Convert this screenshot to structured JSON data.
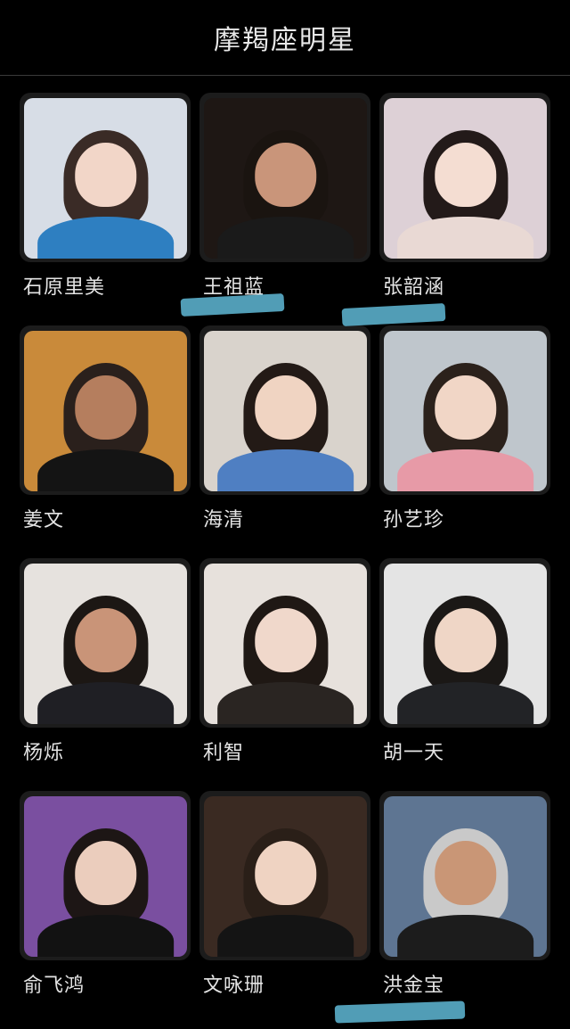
{
  "header": {
    "title": "摩羯座明星"
  },
  "celebrities": [
    {
      "name": "石原里美",
      "photo": {
        "bg": "#d7dde6",
        "hair": "#3a2b26",
        "skin": "#f2d6c8",
        "cloth": "#2e7fc1"
      }
    },
    {
      "name": "王祖蓝",
      "photo": {
        "bg": "#1e1714",
        "hair": "#1a1410",
        "skin": "#c9957a",
        "cloth": "#1a1a1a"
      }
    },
    {
      "name": "张韶涵",
      "photo": {
        "bg": "#ddd0d6",
        "hair": "#231a19",
        "skin": "#f4ddd2",
        "cloth": "#e9d9d4"
      }
    },
    {
      "name": "姜文",
      "photo": {
        "bg": "#c98a3a",
        "hair": "#2a201c",
        "skin": "#b57e5e",
        "cloth": "#141414"
      }
    },
    {
      "name": "海清",
      "photo": {
        "bg": "#d9d3cc",
        "hair": "#231a16",
        "skin": "#f0d4c2",
        "cloth": "#4f7fc2"
      }
    },
    {
      "name": "孙艺珍",
      "photo": {
        "bg": "#bfc6cc",
        "hair": "#2b211b",
        "skin": "#f1d6c6",
        "cloth": "#e79aa7"
      }
    },
    {
      "name": "杨烁",
      "photo": {
        "bg": "#e6e2de",
        "hair": "#1c1714",
        "skin": "#c99478",
        "cloth": "#1f1f24"
      }
    },
    {
      "name": "利智",
      "photo": {
        "bg": "#e7e1dc",
        "hair": "#1f1814",
        "skin": "#f0d8cb",
        "cloth": "#2a2522"
      }
    },
    {
      "name": "胡一天",
      "photo": {
        "bg": "#e4e4e4",
        "hair": "#1b1816",
        "skin": "#efd6c6",
        "cloth": "#222326"
      }
    },
    {
      "name": "俞飞鸿",
      "photo": {
        "bg": "#7a4fa0",
        "hair": "#1d1615",
        "skin": "#ebcdbd",
        "cloth": "#121212"
      }
    },
    {
      "name": "文咏珊",
      "photo": {
        "bg": "#3a2a22",
        "hair": "#2a1f18",
        "skin": "#efd3c2",
        "cloth": "#141414"
      }
    },
    {
      "name": "洪金宝",
      "photo": {
        "bg": "#5e7592",
        "hair": "#c9c9c9",
        "skin": "#c99676",
        "cloth": "#1c1c1c"
      }
    }
  ]
}
